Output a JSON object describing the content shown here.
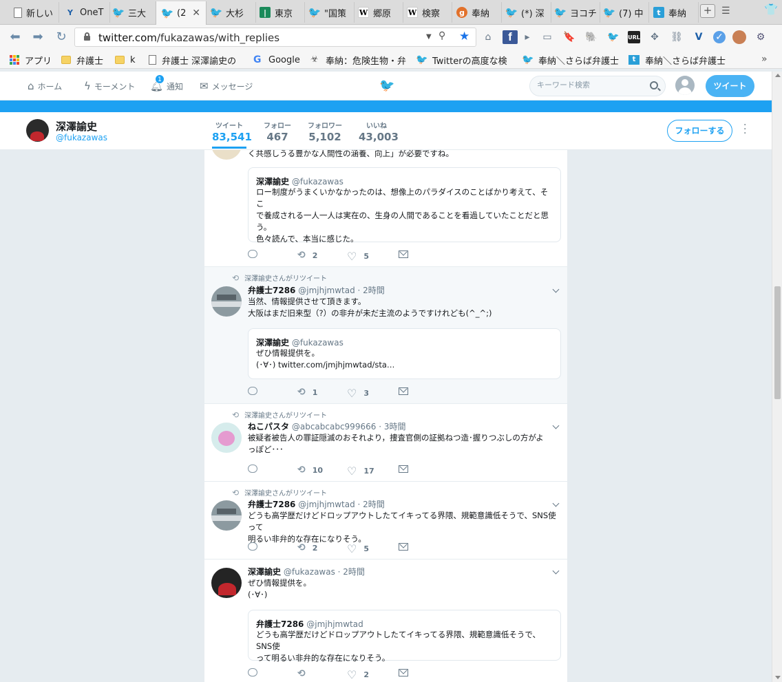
{
  "browser": {
    "tabs": [
      {
        "label": "新しい",
        "icon": "page-icon"
      },
      {
        "label": "OneT",
        "icon": "onetab-icon"
      },
      {
        "label": "三大",
        "icon": "twitter-icon"
      },
      {
        "label": "(2",
        "icon": "twitter-icon",
        "active": true
      },
      {
        "label": "大杉",
        "icon": "twitter-icon"
      },
      {
        "label": "東京",
        "icon": "green-tile-icon"
      },
      {
        "label": "\"国策",
        "icon": "twitter-icon"
      },
      {
        "label": "郷原",
        "icon": "wikipedia-icon"
      },
      {
        "label": "検察",
        "icon": "wikipedia-icon"
      },
      {
        "label": "奉納",
        "icon": "orange-icon"
      },
      {
        "label": "(*) 深",
        "icon": "twitter-icon"
      },
      {
        "label": "ヨコチ",
        "icon": "twitter-icon"
      },
      {
        "label": "(7) 中",
        "icon": "twitter-icon"
      },
      {
        "label": "奉納",
        "icon": "tile-t-icon"
      }
    ],
    "url": {
      "host": "twitter.com",
      "path": "/fukazawas/with_replies"
    },
    "bookmarks": [
      {
        "label": "アプリ",
        "icon": "apps-icon"
      },
      {
        "label": "弁護士",
        "icon": "folder-icon"
      },
      {
        "label": "k",
        "icon": "folder-icon"
      },
      {
        "label": "弁護士 深澤諭史の",
        "icon": "page-icon"
      },
      {
        "label": "Google",
        "icon": "google-icon"
      },
      {
        "label": "奉納：危険生物・弁",
        "icon": "hazard-icon"
      },
      {
        "label": "Twitterの高度な検",
        "icon": "twitter-icon"
      },
      {
        "label": "奉納＼さらば弁護士",
        "icon": "twitter-icon"
      },
      {
        "label": "奉納＼さらば弁護士",
        "icon": "tile-t-icon"
      }
    ]
  },
  "twitter": {
    "nav": {
      "home": "ホーム",
      "moments": "モーメント",
      "notifications": "通知",
      "notif_count": "1",
      "messages": "メッセージ",
      "search_placeholder": "キーワード検索",
      "tweet_button": "ツイート"
    },
    "profile": {
      "name": "深澤諭史",
      "handle": "@fukazawas",
      "stats": [
        {
          "label": "ツイート",
          "value": "83,541"
        },
        {
          "label": "フォロー",
          "value": "467"
        },
        {
          "label": "フォロワー",
          "value": "5,102"
        },
        {
          "label": "いいね",
          "value": "43,003"
        }
      ],
      "follow_button": "フォローする"
    },
    "tweets": [
      {
        "text_tail": "く共感しうる豊かな人間性の涵養、向上」が必要ですね。",
        "quote": {
          "name": "深澤諭史",
          "handle": "@fukazawas",
          "text": "ロー制度がうまくいかなかったのは、想像上のパラダイスのことばかり考えて、そこ\nで養成される一人一人は実在の、生身の人間であることを看過していたことだと思\nう。\n色々読んで、本当に感じた。"
        },
        "retweets": "2",
        "likes": "5"
      },
      {
        "context": "深澤諭史さんがリツイート",
        "name": "弁護士7286",
        "handle": "@jmjhjmwtad",
        "time": "· 2時間",
        "text": "当然、情報提供させて頂きます。\n大阪はまだ旧来型（?）の非弁が未だ主流のようですけれども(^_^;)",
        "quote": {
          "name": "深澤諭史",
          "handle": "@fukazawas",
          "text": "ぜひ情報提供を。\n(･∀･) twitter.com/jmjhjmwtad/sta…"
        },
        "retweets": "1",
        "likes": "3"
      },
      {
        "context": "深澤諭史さんがリツイート",
        "name": "ねこパスタ",
        "handle": "@abcabcabc999666",
        "time": "· 3時間",
        "text": "被疑者被告人の罪証隠滅のおそれより，捜査官側の証拠ねつ造･握りつぶしの方がよ\nっぽど･･･",
        "retweets": "10",
        "likes": "17"
      },
      {
        "context": "深澤諭史さんがリツイート",
        "name": "弁護士7286",
        "handle": "@jmjhjmwtad",
        "time": "· 2時間",
        "text": "どうも高学歴だけどドロップアウトしたてイキってる界隈、規範意識低そうで、SNS使って\n明るい非弁的な存在になりそう。",
        "retweets": "2",
        "likes": "5"
      },
      {
        "name": "深澤諭史",
        "handle": "@fukazawas",
        "time": "· 2時間",
        "text": "ぜひ情報提供を。\n(･∀･)",
        "quote": {
          "name": "弁護士7286",
          "handle": "@jmjhjmwtad",
          "text": "どうも高学歴だけどドロップアウトしたてイキってる界隈、規範意識低そうで、SNS使\nって明るい非弁的な存在になりそう。"
        },
        "retweets": "",
        "likes": "2"
      }
    ]
  }
}
